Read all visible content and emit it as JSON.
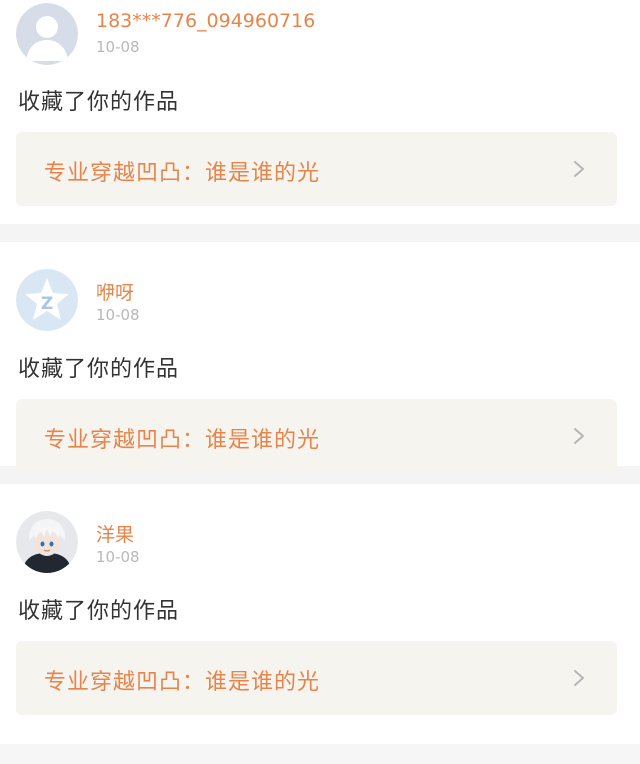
{
  "notifications": [
    {
      "username": "183***776_094960716",
      "date": "10-08",
      "action": "收藏了你的作品",
      "work_title": "专业穿越凹凸：谁是谁的光",
      "avatar_icon": "default-person-avatar-icon"
    },
    {
      "username": "咿呀",
      "date": "10-08",
      "action": "收藏了你的作品",
      "work_title": "专业穿越凹凸：谁是谁的光",
      "avatar_icon": "qzone-star-avatar-icon"
    },
    {
      "username": "洋果",
      "date": "10-08",
      "action": "收藏了你的作品",
      "work_title": "专业穿越凹凸：谁是谁的光",
      "avatar_icon": "anime-character-avatar-icon"
    }
  ],
  "colors": {
    "accent": "#e8844a",
    "date": "#b8b8b8",
    "text": "#333333",
    "work_bg": "#f5f4ef",
    "separator": "#f4f4f4"
  }
}
